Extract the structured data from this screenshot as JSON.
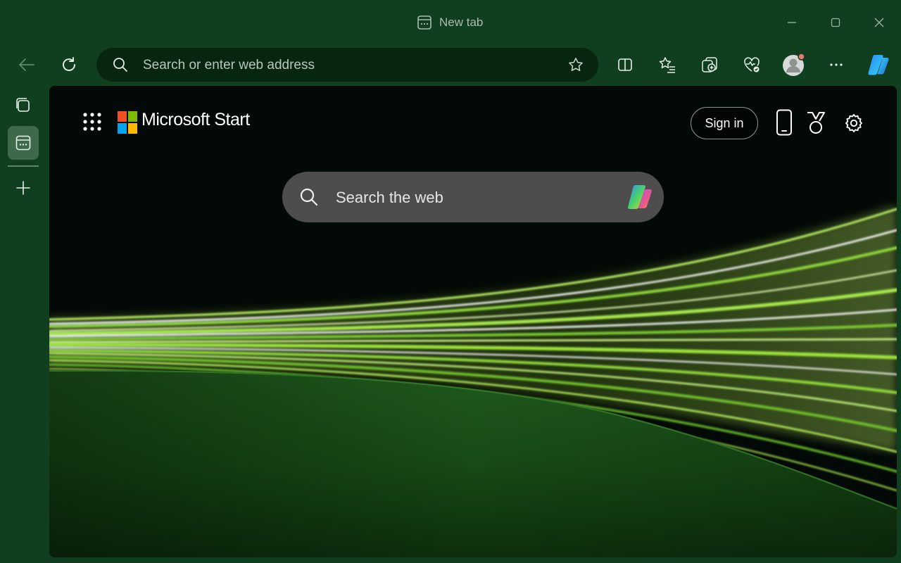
{
  "window": {
    "tab_title": "New tab"
  },
  "toolbar": {
    "address_placeholder": "Search or enter web address"
  },
  "page": {
    "brand": "Microsoft Start",
    "sign_in_label": "Sign in",
    "search_placeholder": "Search the web"
  },
  "colors": {
    "frame": "#0f3f1f",
    "address_bar": "#07250f",
    "content_background": "#030906",
    "search_box": "#525453",
    "accent_green": "#9be33a"
  },
  "icons": {
    "title": "tab-page-icon",
    "back": "arrow-left-icon",
    "refresh": "refresh-icon",
    "favorite": "star-icon",
    "split_screen": "split-screen-icon",
    "favorites": "favorites-list-icon",
    "collections": "collections-icon",
    "health": "heart-pulse-icon",
    "profile": "avatar-icon",
    "more": "ellipsis-icon",
    "copilot": "copilot-icon",
    "apps": "app-grid-icon",
    "phone": "phone-icon",
    "rewards": "medal-icon",
    "settings": "gear-icon"
  }
}
